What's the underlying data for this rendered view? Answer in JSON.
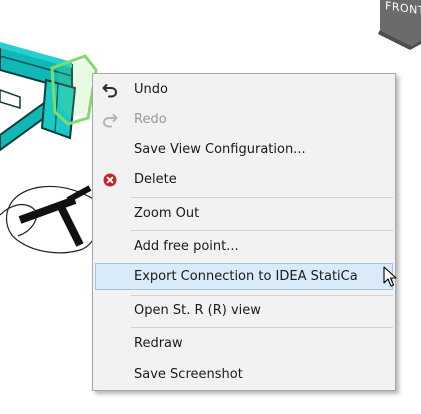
{
  "scene": {
    "nav_cube_label": "FRONT"
  },
  "context_menu": {
    "items": [
      {
        "label": "Undo",
        "icon": "undo-icon",
        "enabled": true
      },
      {
        "label": "Redo",
        "icon": "redo-icon",
        "enabled": false
      },
      {
        "label": "Save View Configuration...",
        "icon": null,
        "enabled": true
      },
      {
        "label": "Delete",
        "icon": "delete-icon",
        "enabled": true
      },
      {
        "label": "Zoom Out",
        "icon": null,
        "enabled": true
      },
      {
        "label": "Add free point...",
        "icon": null,
        "enabled": true
      },
      {
        "label": "Export Connection to IDEA StatiCa",
        "icon": null,
        "enabled": true,
        "highlighted": true
      },
      {
        "label": "Open St. R (R) view",
        "icon": null,
        "enabled": true
      },
      {
        "label": "Redraw",
        "icon": null,
        "enabled": true
      },
      {
        "label": "Save Screenshot",
        "icon": null,
        "enabled": true
      }
    ]
  },
  "colors": {
    "menu_background": "#f2f2f2",
    "highlight_background": "#d9eaf9",
    "highlight_border": "#9dc3ea",
    "disabled_text": "#9a9a9a",
    "delete_icon": "#c0282d",
    "member_fill": "#00b3b3",
    "selection_box": "#7fdc6a",
    "nav_cube": "#6b6b6b"
  }
}
